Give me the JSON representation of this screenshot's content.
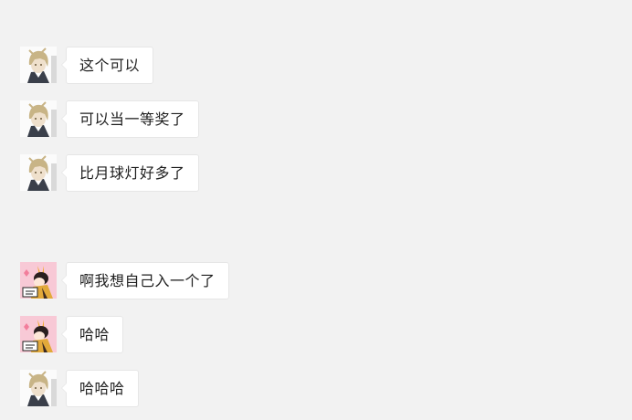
{
  "messages": [
    {
      "sender": "avatar-blonde-boy",
      "text": "这个可以"
    },
    {
      "sender": "avatar-blonde-boy",
      "text": "可以当一等奖了"
    },
    {
      "sender": "avatar-blonde-boy",
      "text": "比月球灯好多了"
    },
    {
      "sender": "avatar-cartoon-girl",
      "text": "啊我想自己入一个了"
    },
    {
      "sender": "avatar-cartoon-girl",
      "text": "哈哈"
    },
    {
      "sender": "avatar-blonde-boy",
      "text": "哈哈哈"
    }
  ],
  "colors": {
    "page_background": "#f2f2f2",
    "bubble_background": "#ffffff",
    "bubble_border": "#e6e6e6",
    "text": "#1f1f1f"
  }
}
